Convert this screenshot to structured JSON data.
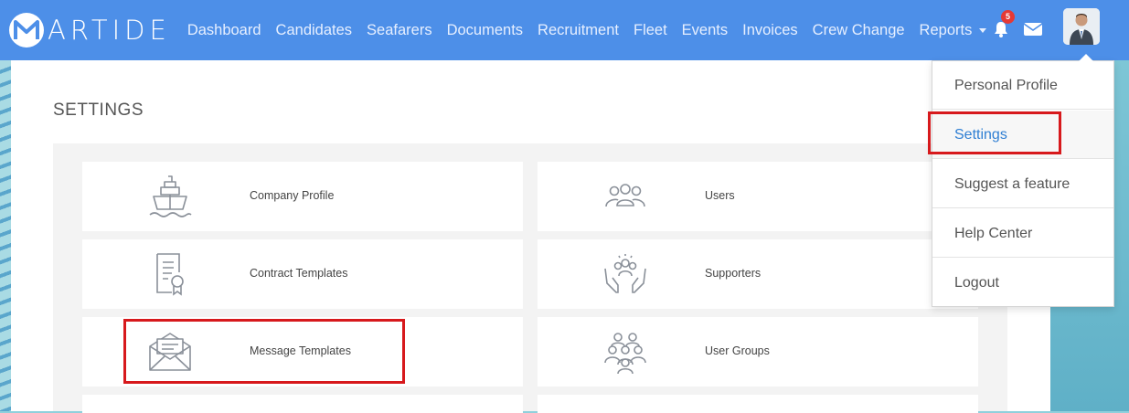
{
  "brand": {
    "name": "ARTIDE",
    "accent": "#4d8fe8"
  },
  "nav": {
    "links": [
      "Dashboard",
      "Candidates",
      "Seafarers",
      "Documents",
      "Recruitment",
      "Fleet",
      "Events",
      "Invoices",
      "Crew Change"
    ],
    "reports_label": "Reports",
    "notification_count": "5"
  },
  "page": {
    "title": "SETTINGS"
  },
  "cards": [
    {
      "label": "Company Profile",
      "icon": "ship-icon"
    },
    {
      "label": "Users",
      "icon": "users-icon"
    },
    {
      "label": "Contract Templates",
      "icon": "certificate-icon"
    },
    {
      "label": "Supporters",
      "icon": "supporters-icon"
    },
    {
      "label": "Message Templates",
      "icon": "envelope-open-icon"
    },
    {
      "label": "User Groups",
      "icon": "user-groups-icon"
    }
  ],
  "dropdown": {
    "items": [
      "Personal Profile",
      "Settings",
      "Suggest a feature",
      "Help Center",
      "Logout"
    ],
    "active": "Settings"
  },
  "highlight_color": "#d7191c"
}
